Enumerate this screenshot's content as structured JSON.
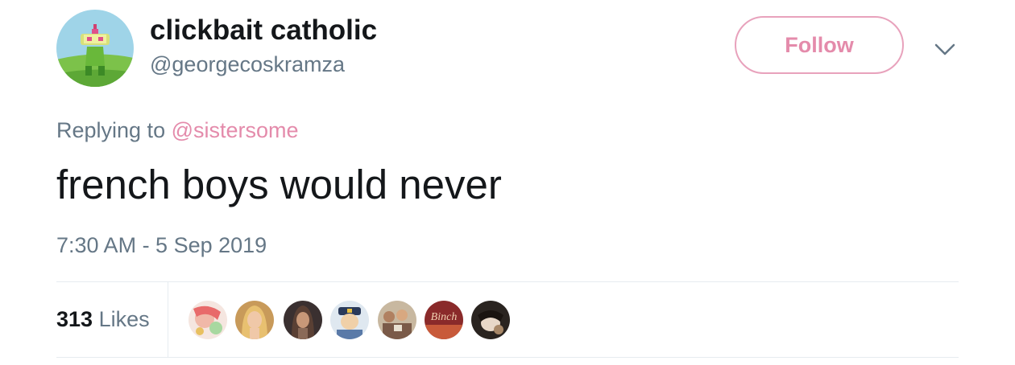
{
  "author": {
    "display_name": "clickbait catholic",
    "handle": "@georgecoskramza",
    "avatar_icon": "katamari-prince-avatar"
  },
  "follow_label": "Follow",
  "more_icon": "chevron-down-icon",
  "reply": {
    "prefix": "Replying to ",
    "to": "@sistersome"
  },
  "tweet_text": "french boys would never",
  "timestamp": "7:30 AM - 5 Sep 2019",
  "likes": {
    "count": "313",
    "label": " Likes"
  },
  "liker_avatars": [
    {
      "icon": "anime-illustration-avatar"
    },
    {
      "icon": "blonde-person-avatar"
    },
    {
      "icon": "dark-haired-person-avatar"
    },
    {
      "icon": "cartoon-officer-avatar"
    },
    {
      "icon": "group-photo-avatar"
    },
    {
      "icon": "binch-logo-avatar",
      "text": "Binch"
    },
    {
      "icon": "dark-photo-avatar"
    }
  ],
  "colors": {
    "accent": "#e48bab",
    "follow_border": "#e8a2bc",
    "text_primary": "#14171a",
    "text_secondary": "#657786",
    "divider": "#e6ecf0"
  }
}
